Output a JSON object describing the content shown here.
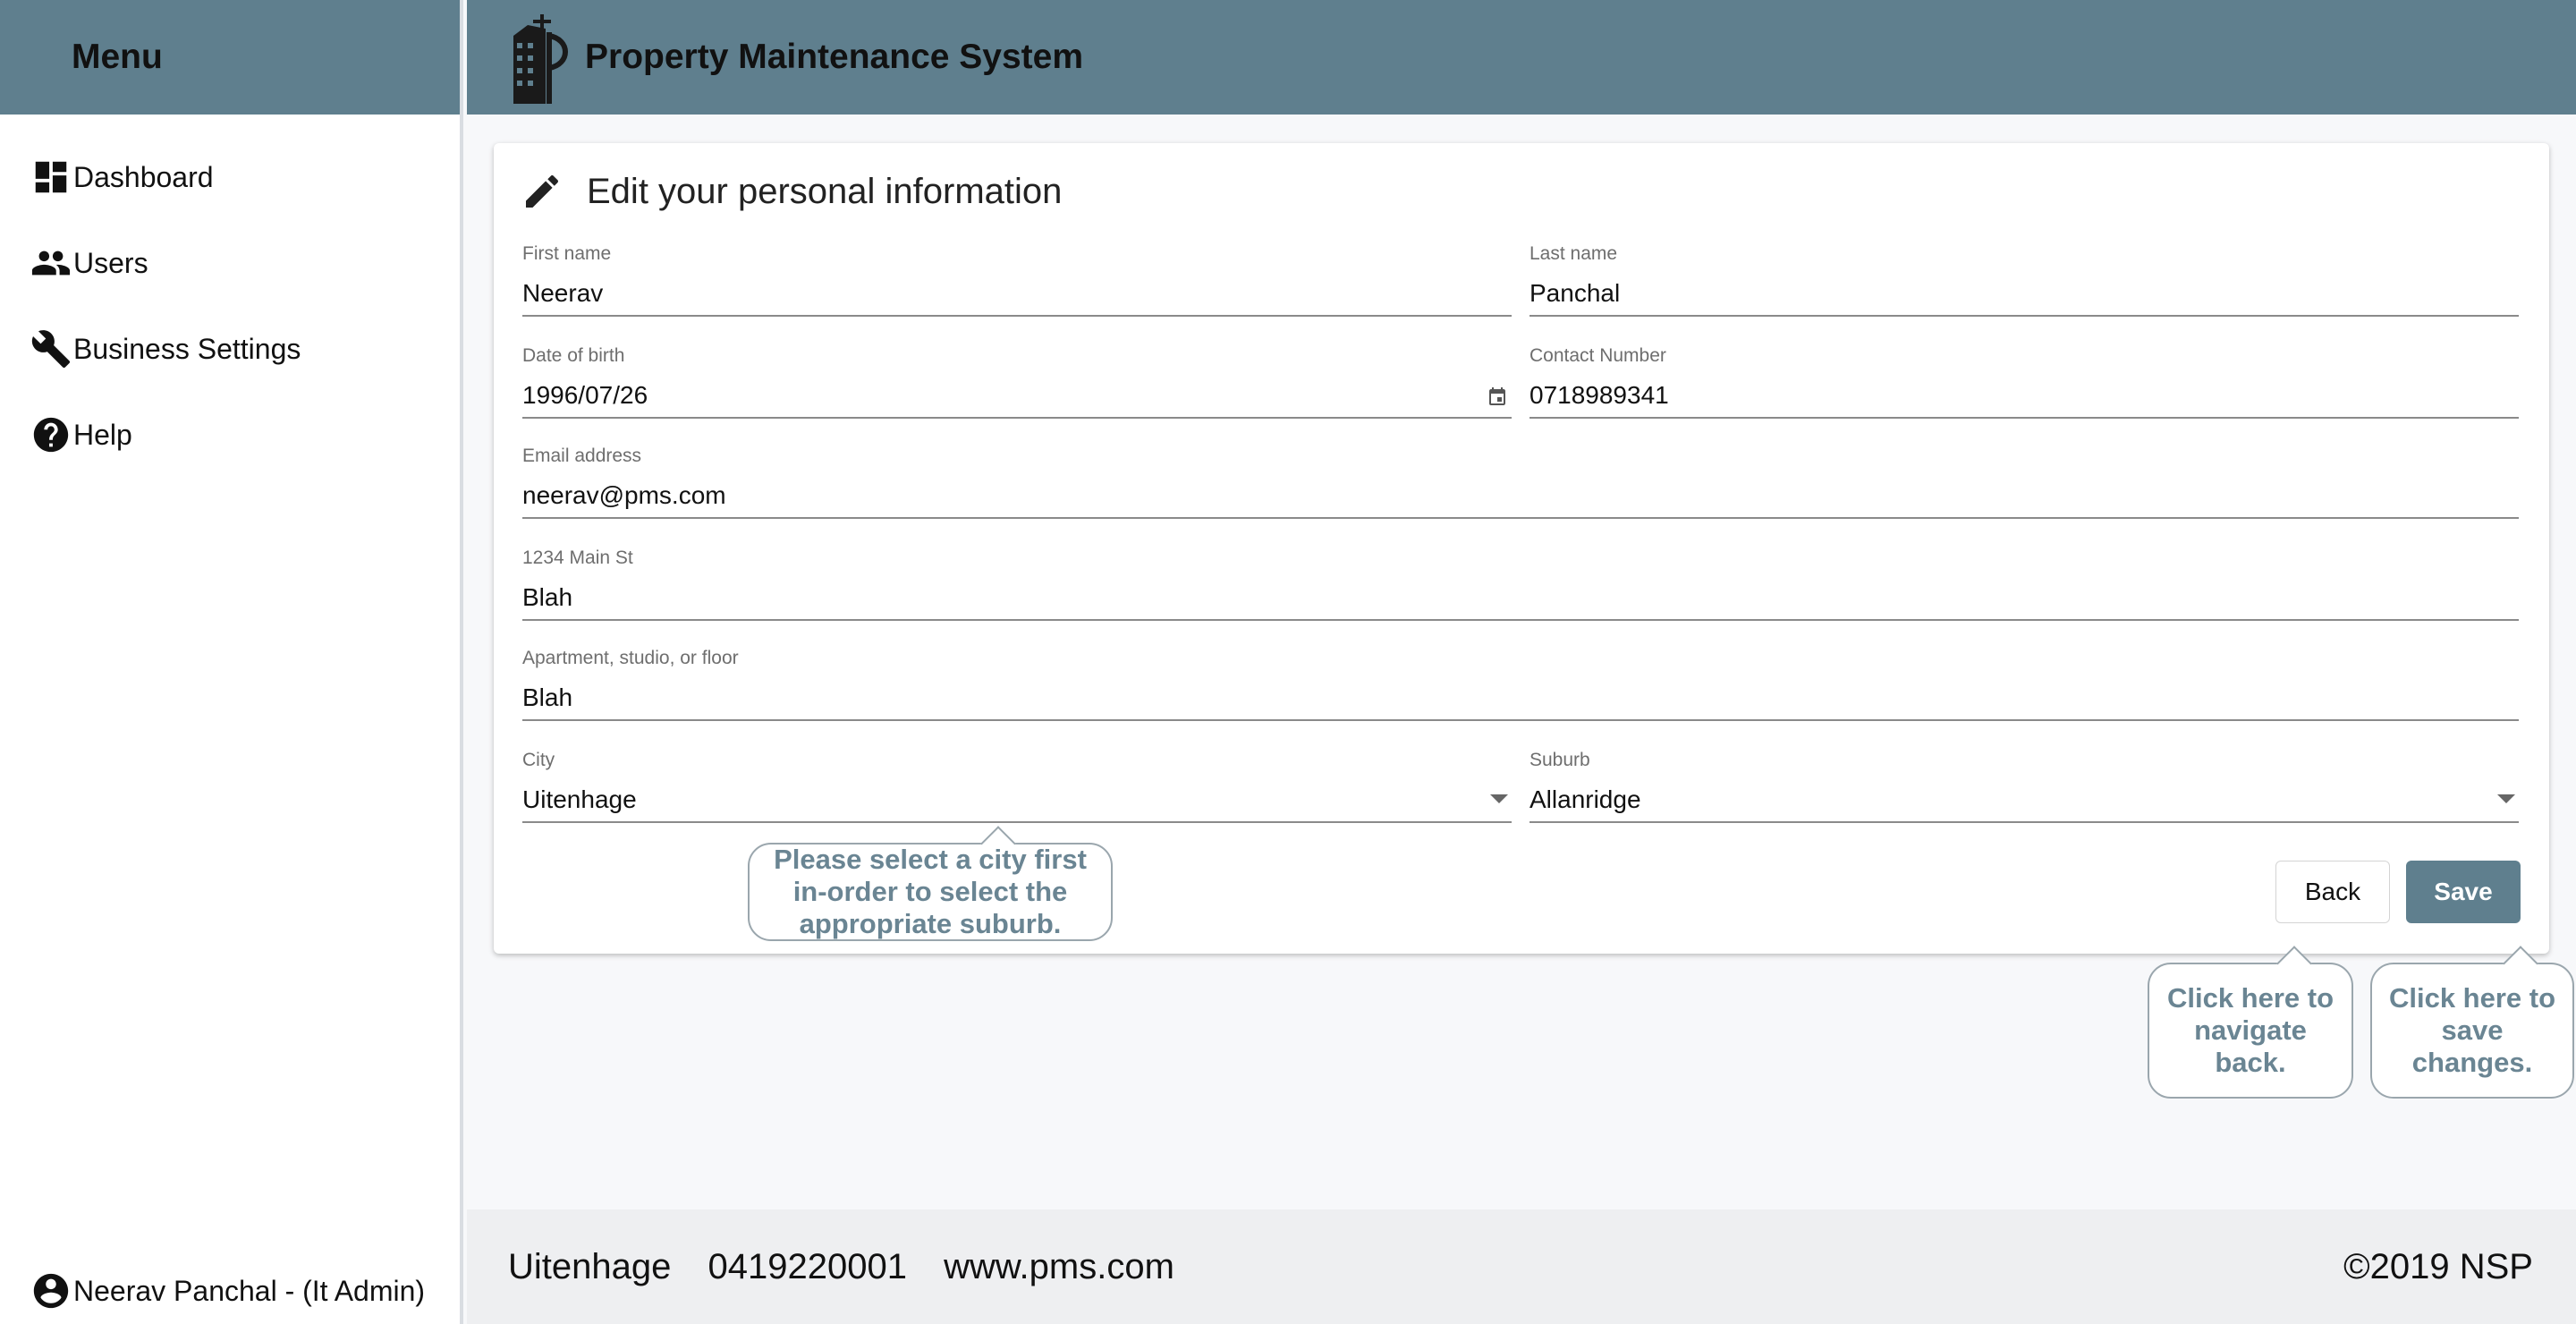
{
  "sidebar": {
    "title": "Menu",
    "items": [
      {
        "label": "Dashboard",
        "icon": "dashboard-icon"
      },
      {
        "label": "Users",
        "icon": "users-icon"
      },
      {
        "label": "Business Settings",
        "icon": "wrench-icon"
      },
      {
        "label": "Help",
        "icon": "help-icon"
      }
    ],
    "user": "Neerav Panchal - (It Admin)"
  },
  "header": {
    "title": "Property Maintenance System"
  },
  "form": {
    "title": "Edit your personal information",
    "first_name": {
      "label": "First name",
      "value": "Neerav"
    },
    "last_name": {
      "label": "Last name",
      "value": "Panchal"
    },
    "dob": {
      "label": "Date of birth",
      "value": "1996/07/26"
    },
    "contact": {
      "label": "Contact Number",
      "value": "0718989341"
    },
    "email": {
      "label": "Email address",
      "value": "neerav@pms.com"
    },
    "address1": {
      "label": "1234 Main St",
      "value": "Blah"
    },
    "address2": {
      "label": "Apartment, studio, or floor",
      "value": "Blah"
    },
    "city": {
      "label": "City",
      "value": "Uitenhage"
    },
    "suburb": {
      "label": "Suburb",
      "value": "Allanridge"
    },
    "back_label": "Back",
    "save_label": "Save"
  },
  "tooltips": {
    "city": "Please select a city first in-order to select the appropriate suburb.",
    "back": "Click here to navigate back.",
    "save": "Click here to save changes."
  },
  "footer": {
    "city": "Uitenhage",
    "phone": "0419220001",
    "website": "www.pms.com",
    "copyright": "©2019 NSP"
  },
  "colors": {
    "header_bg": "#5f7f8e",
    "accent": "#5f7f8e",
    "tooltip_text": "#6a8593"
  }
}
